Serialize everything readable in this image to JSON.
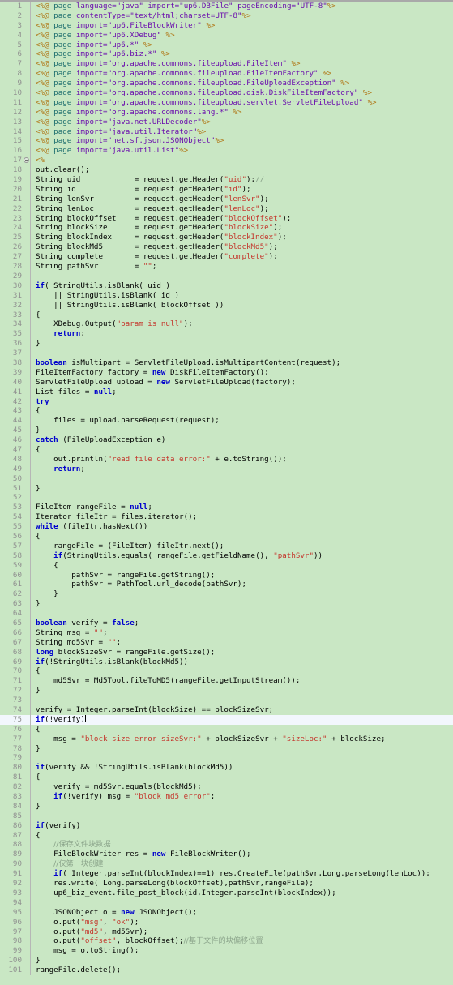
{
  "editor": {
    "name": "jsp-source-editor",
    "language": "JSP / Java",
    "cursor_line": 75,
    "folded_line": 17,
    "colors": {
      "background": "#c9e7c4",
      "cursor_line_background": "#f2f7fd",
      "gutter_text": "#909090",
      "keyword": "#0000cd",
      "string": "#c4352b",
      "comment": "#8aa38a",
      "directive": "#b07818",
      "tag": "#1f6f6f",
      "attribute": "#6a0dad",
      "plain_text": "#000000"
    },
    "first_line": 1,
    "last_line": 101,
    "total_visible_lines": 101
  },
  "lines": [
    {
      "n": 1,
      "text": "<%@ page language=\"java\" import=\"up6.DBFile\" pageEncoding=\"UTF-8\"%>"
    },
    {
      "n": 2,
      "text": "<%@ page contentType=\"text/html;charset=UTF-8\"%>"
    },
    {
      "n": 3,
      "text": "<%@ page import=\"up6.FileBlockWriter\" %>"
    },
    {
      "n": 4,
      "text": "<%@ page import=\"up6.XDebug\" %>"
    },
    {
      "n": 5,
      "text": "<%@ page import=\"up6.*\" %>"
    },
    {
      "n": 6,
      "text": "<%@ page import=\"up6.biz.*\" %>"
    },
    {
      "n": 7,
      "text": "<%@ page import=\"org.apache.commons.fileupload.FileItem\" %>"
    },
    {
      "n": 8,
      "text": "<%@ page import=\"org.apache.commons.fileupload.FileItemFactory\" %>"
    },
    {
      "n": 9,
      "text": "<%@ page import=\"org.apache.commons.fileupload.FileUploadException\" %>"
    },
    {
      "n": 10,
      "text": "<%@ page import=\"org.apache.commons.fileupload.disk.DiskFileItemFactory\" %>"
    },
    {
      "n": 11,
      "text": "<%@ page import=\"org.apache.commons.fileupload.servlet.ServletFileUpload\" %>"
    },
    {
      "n": 12,
      "text": "<%@ page import=\"org.apache.commons.lang.*\" %>"
    },
    {
      "n": 13,
      "text": "<%@ page import=\"java.net.URLDecoder\"%>"
    },
    {
      "n": 14,
      "text": "<%@ page import=\"java.util.Iterator\"%>"
    },
    {
      "n": 15,
      "text": "<%@ page import=\"net.sf.json.JSONObject\"%>"
    },
    {
      "n": 16,
      "text": "<%@ page import=\"java.util.List\"%>"
    },
    {
      "n": 17,
      "text": "<%"
    },
    {
      "n": 18,
      "text": "out.clear();"
    },
    {
      "n": 19,
      "text": "String uid            = request.getHeader(\"uid\");//"
    },
    {
      "n": 20,
      "text": "String id             = request.getHeader(\"id\");"
    },
    {
      "n": 21,
      "text": "String lenSvr         = request.getHeader(\"lenSvr\");"
    },
    {
      "n": 22,
      "text": "String lenLoc         = request.getHeader(\"lenLoc\");"
    },
    {
      "n": 23,
      "text": "String blockOffset    = request.getHeader(\"blockOffset\");"
    },
    {
      "n": 24,
      "text": "String blockSize      = request.getHeader(\"blockSize\");"
    },
    {
      "n": 25,
      "text": "String blockIndex     = request.getHeader(\"blockIndex\");"
    },
    {
      "n": 26,
      "text": "String blockMd5       = request.getHeader(\"blockMd5\");"
    },
    {
      "n": 27,
      "text": "String complete       = request.getHeader(\"complete\");"
    },
    {
      "n": 28,
      "text": "String pathSvr        = \"\";"
    },
    {
      "n": 29,
      "text": ""
    },
    {
      "n": 30,
      "text": "if( StringUtils.isBlank( uid )"
    },
    {
      "n": 31,
      "text": "    || StringUtils.isBlank( id )"
    },
    {
      "n": 32,
      "text": "    || StringUtils.isBlank( blockOffset ))"
    },
    {
      "n": 33,
      "text": "{"
    },
    {
      "n": 34,
      "text": "    XDebug.Output(\"param is null\");"
    },
    {
      "n": 35,
      "text": "    return;"
    },
    {
      "n": 36,
      "text": "}"
    },
    {
      "n": 37,
      "text": ""
    },
    {
      "n": 38,
      "text": "boolean isMultipart = ServletFileUpload.isMultipartContent(request);"
    },
    {
      "n": 39,
      "text": "FileItemFactory factory = new DiskFileItemFactory();"
    },
    {
      "n": 40,
      "text": "ServletFileUpload upload = new ServletFileUpload(factory);"
    },
    {
      "n": 41,
      "text": "List files = null;"
    },
    {
      "n": 42,
      "text": "try"
    },
    {
      "n": 43,
      "text": "{"
    },
    {
      "n": 44,
      "text": "    files = upload.parseRequest(request);"
    },
    {
      "n": 45,
      "text": "}"
    },
    {
      "n": 46,
      "text": "catch (FileUploadException e)"
    },
    {
      "n": 47,
      "text": "{"
    },
    {
      "n": 48,
      "text": "    out.println(\"read file data error:\" + e.toString());"
    },
    {
      "n": 49,
      "text": "    return;"
    },
    {
      "n": 50,
      "text": ""
    },
    {
      "n": 51,
      "text": "}"
    },
    {
      "n": 52,
      "text": ""
    },
    {
      "n": 53,
      "text": "FileItem rangeFile = null;"
    },
    {
      "n": 54,
      "text": "Iterator fileItr = files.iterator();"
    },
    {
      "n": 55,
      "text": "while (fileItr.hasNext())"
    },
    {
      "n": 56,
      "text": "{"
    },
    {
      "n": 57,
      "text": "    rangeFile = (FileItem) fileItr.next();"
    },
    {
      "n": 58,
      "text": "    if(StringUtils.equals( rangeFile.getFieldName(), \"pathSvr\"))"
    },
    {
      "n": 59,
      "text": "    {"
    },
    {
      "n": 60,
      "text": "        pathSvr = rangeFile.getString();"
    },
    {
      "n": 61,
      "text": "        pathSvr = PathTool.url_decode(pathSvr);"
    },
    {
      "n": 62,
      "text": "    }"
    },
    {
      "n": 63,
      "text": "}"
    },
    {
      "n": 64,
      "text": ""
    },
    {
      "n": 65,
      "text": "boolean verify = false;"
    },
    {
      "n": 66,
      "text": "String msg = \"\";"
    },
    {
      "n": 67,
      "text": "String md5Svr = \"\";"
    },
    {
      "n": 68,
      "text": "long blockSizeSvr = rangeFile.getSize();"
    },
    {
      "n": 69,
      "text": "if(!StringUtils.isBlank(blockMd5))"
    },
    {
      "n": 70,
      "text": "{"
    },
    {
      "n": 71,
      "text": "    md5Svr = Md5Tool.fileToMD5(rangeFile.getInputStream());"
    },
    {
      "n": 72,
      "text": "}"
    },
    {
      "n": 73,
      "text": ""
    },
    {
      "n": 74,
      "text": "verify = Integer.parseInt(blockSize) == blockSizeSvr;"
    },
    {
      "n": 75,
      "text": "if(!verify)"
    },
    {
      "n": 76,
      "text": "{"
    },
    {
      "n": 77,
      "text": "    msg = \"block size error sizeSvr:\" + blockSizeSvr + \"sizeLoc:\" + blockSize;"
    },
    {
      "n": 78,
      "text": "}"
    },
    {
      "n": 79,
      "text": ""
    },
    {
      "n": 80,
      "text": "if(verify && !StringUtils.isBlank(blockMd5))"
    },
    {
      "n": 81,
      "text": "{"
    },
    {
      "n": 82,
      "text": "    verify = md5Svr.equals(blockMd5);"
    },
    {
      "n": 83,
      "text": "    if(!verify) msg = \"block md5 error\";"
    },
    {
      "n": 84,
      "text": "}"
    },
    {
      "n": 85,
      "text": ""
    },
    {
      "n": 86,
      "text": "if(verify)"
    },
    {
      "n": 87,
      "text": "{"
    },
    {
      "n": 88,
      "text": "    //保存文件块数据"
    },
    {
      "n": 89,
      "text": "    FileBlockWriter res = new FileBlockWriter();"
    },
    {
      "n": 90,
      "text": "    //仅第一块创建"
    },
    {
      "n": 91,
      "text": "    if( Integer.parseInt(blockIndex)==1) res.CreateFile(pathSvr,Long.parseLong(lenLoc));"
    },
    {
      "n": 92,
      "text": "    res.write( Long.parseLong(blockOffset),pathSvr,rangeFile);"
    },
    {
      "n": 93,
      "text": "    up6_biz_event.file_post_block(id,Integer.parseInt(blockIndex));"
    },
    {
      "n": 94,
      "text": ""
    },
    {
      "n": 95,
      "text": "    JSONObject o = new JSONObject();"
    },
    {
      "n": 96,
      "text": "    o.put(\"msg\", \"ok\");"
    },
    {
      "n": 97,
      "text": "    o.put(\"md5\", md5Svr);"
    },
    {
      "n": 98,
      "text": "    o.put(\"offset\", blockOffset);//基于文件的块偏移位置"
    },
    {
      "n": 99,
      "text": "    msg = o.toString();"
    },
    {
      "n": 100,
      "text": "}"
    },
    {
      "n": 101,
      "text": "rangeFile.delete();"
    }
  ],
  "highlight": {
    "keywords": [
      "if",
      "else",
      "return",
      "new",
      "try",
      "catch",
      "while",
      "boolean",
      "long",
      "false",
      "null",
      "true"
    ],
    "cursor_line_text": "if(!verify)"
  }
}
